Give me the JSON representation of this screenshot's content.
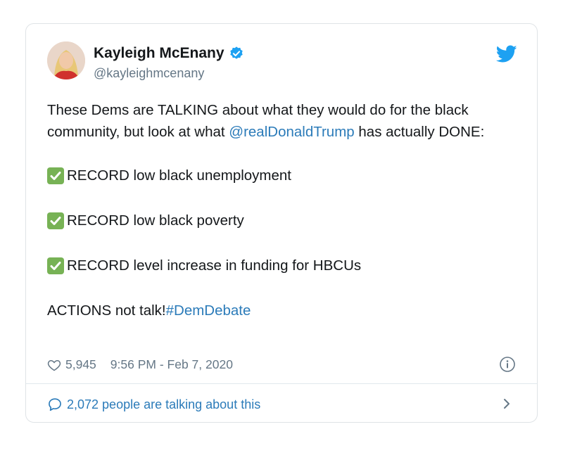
{
  "tweet": {
    "author_name": "Kayleigh McEnany",
    "handle": "@kayleighmcenany",
    "intro_part1": "These Dems are TALKING about what they would do for the black community, but look at what ",
    "mention": "@realDonaldTrump",
    "intro_part2": " has actually DONE:",
    "bullets": [
      "RECORD low black unemployment",
      "RECORD low black poverty",
      "RECORD level increase in funding for HBCUs"
    ],
    "closing_text": "ACTIONS not talk!",
    "hashtag": "#DemDebate",
    "likes": "5,945",
    "timestamp": "9:56 PM - Feb 7, 2020",
    "conversation": "2,072 people are talking about this"
  },
  "icons": {
    "verified": "verified-badge-icon",
    "twitter": "twitter-bird-icon",
    "check": "check-mark-emoji-icon",
    "heart": "heart-icon",
    "info": "info-icon",
    "reply": "speech-bubble-icon",
    "chevron": "chevron-right-icon"
  },
  "colors": {
    "link": "#2b7bb9",
    "secondary_text": "#657786",
    "twitter_blue": "#1da1f2",
    "check_green": "#77b255"
  }
}
